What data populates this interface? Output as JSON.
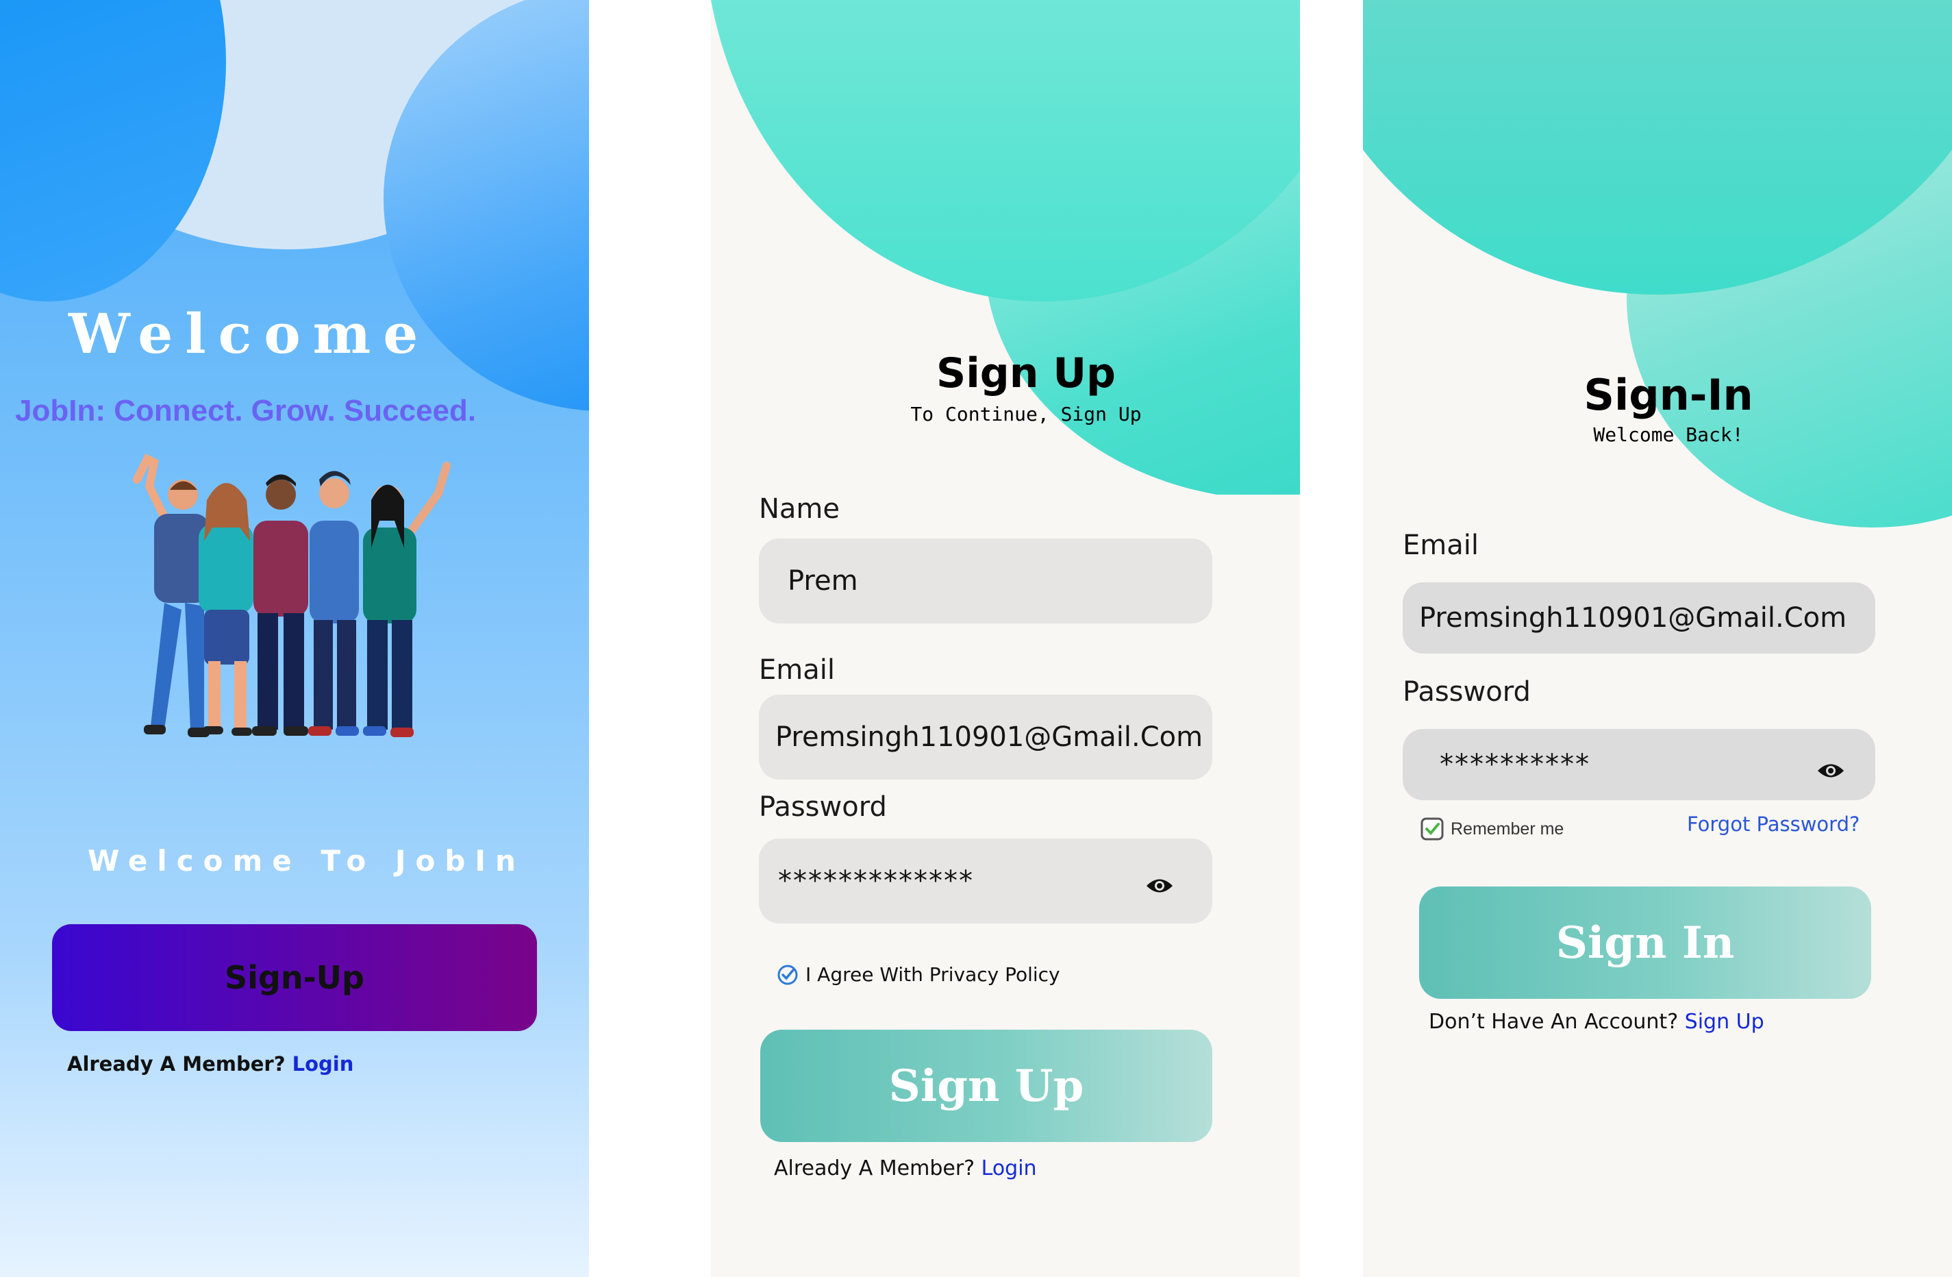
{
  "welcome_screen": {
    "title": "Welcome",
    "tagline": "JobIn: Connect. Grow. Succeed.",
    "subtitle": "Welcome To JobIn",
    "signup_button": "Sign-Up",
    "member_text": "Already A Member?",
    "login_link": "Login",
    "illustration": "group-of-people-illustration",
    "colors": {
      "button_start": "#3a07d0",
      "button_end": "#79038a",
      "tagline": "#6a63f2"
    }
  },
  "signup_screen": {
    "title": "Sign Up",
    "subtitle": "To Continue, Sign Up",
    "name_label": "Name",
    "name_value": "Prem",
    "email_label": "Email",
    "email_value": "Premsingh110901@Gmail.Com",
    "password_label": "Password",
    "password_value": "*************",
    "password_toggle_icon": "eye-icon",
    "agree_text": "I Agree With Privacy Policy",
    "agree_checked": true,
    "submit_button": "Sign Up",
    "member_text": "Already A Member?",
    "login_link": "Login"
  },
  "signin_screen": {
    "title": "Sign-In",
    "subtitle": "Welcome Back!",
    "email_label": "Email",
    "email_value": "Premsingh110901@Gmail.Com",
    "password_label": "Password",
    "password_value": "**********",
    "password_toggle_icon": "eye-icon",
    "remember_text": "Remember me",
    "remember_checked": true,
    "forgot_link": "Forgot Password?",
    "submit_button": "Sign In",
    "no_account_text": "Don’t Have An Account?",
    "signup_link": "Sign Up"
  },
  "accent_color": "#1429d6",
  "teal_gradient": [
    "#5fc0b5",
    "#b5dfd9"
  ]
}
